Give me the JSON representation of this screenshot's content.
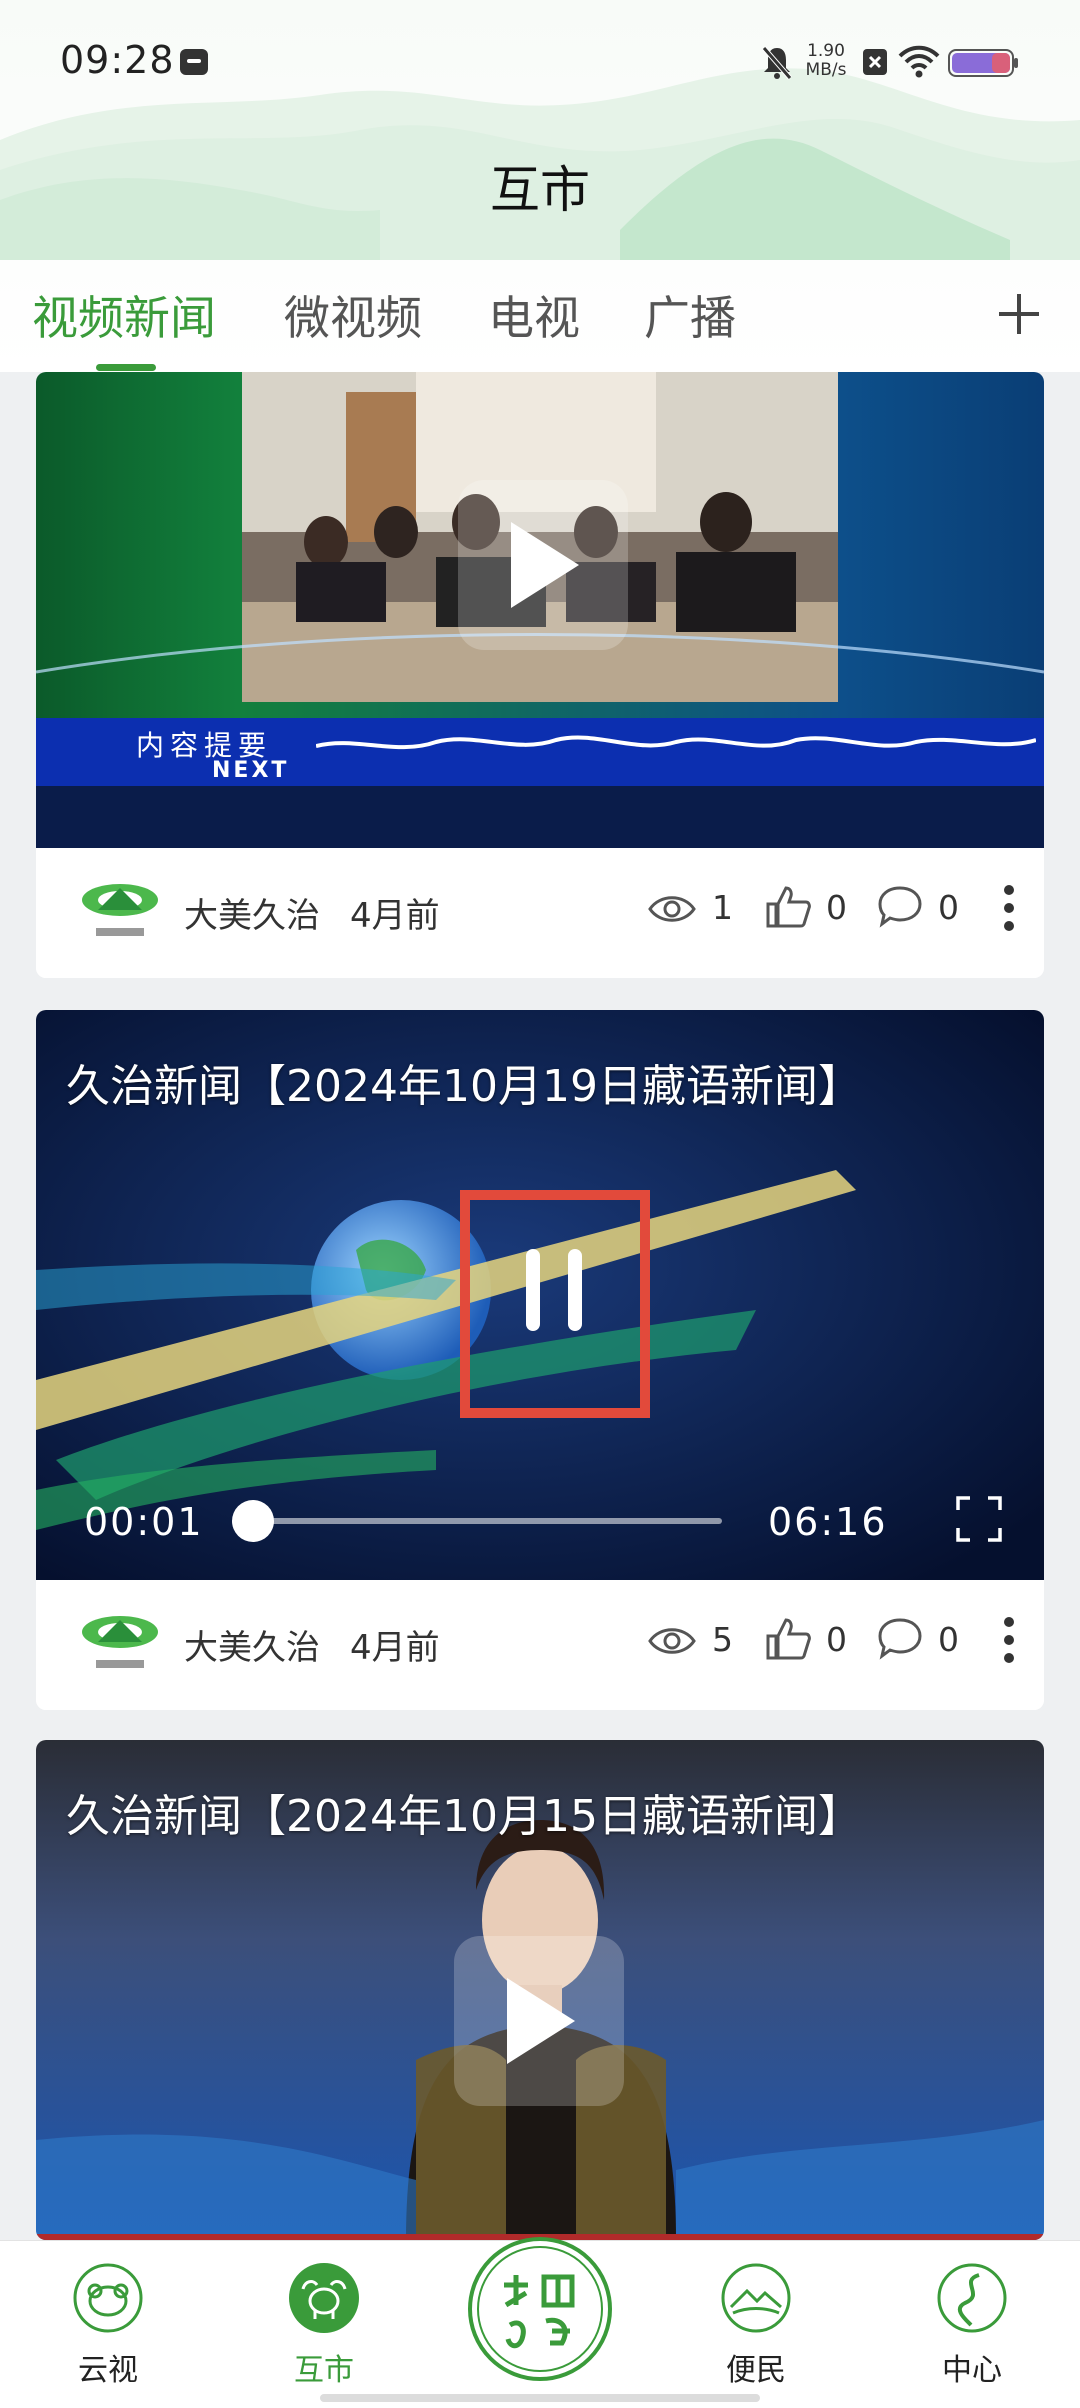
{
  "status_bar": {
    "time": "09:28",
    "speed_value": "1.90",
    "speed_unit": "MB/s"
  },
  "header": {
    "title": "互市"
  },
  "tabs": [
    {
      "label": "视频新闻",
      "active": true
    },
    {
      "label": "微视频",
      "active": false
    },
    {
      "label": "电视",
      "active": false
    },
    {
      "label": "广播",
      "active": false
    }
  ],
  "feed": {
    "items": [
      {
        "author": "大美久治",
        "ago": "4月前",
        "views": "1",
        "likes": "0",
        "comments": "0",
        "banner_left": "内容提要",
        "banner_next": "NEXT"
      },
      {
        "title": "久治新闻【2024年10月19日藏语新闻】",
        "author": "大美久治",
        "ago": "4月前",
        "views": "5",
        "likes": "0",
        "comments": "0",
        "time_current": "00:01",
        "time_total": "06:16",
        "progress": 0.003
      },
      {
        "title": "久治新闻【2024年10月15日藏语新闻】"
      }
    ]
  },
  "bottom_nav": [
    {
      "label": "云视",
      "active": false,
      "icon": "sheep-icon"
    },
    {
      "label": "互市",
      "active": true,
      "icon": "yak-icon"
    },
    {
      "label": "",
      "active": false,
      "icon": "logo-emblem"
    },
    {
      "label": "便民",
      "active": false,
      "icon": "landscape-icon"
    },
    {
      "label": "中心",
      "active": false,
      "icon": "road-icon"
    }
  ],
  "colors": {
    "accent": "#3a9b3a",
    "highlight_box": "#e24a3b"
  }
}
